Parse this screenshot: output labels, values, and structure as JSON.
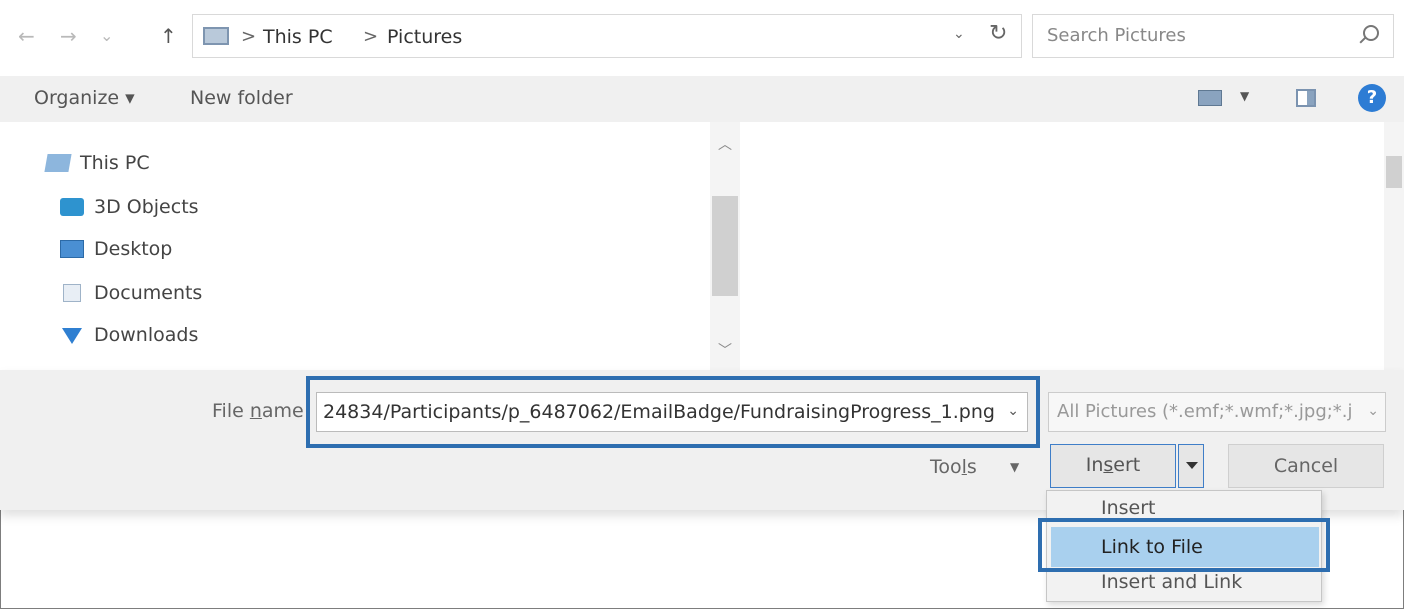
{
  "navigation": {
    "back": "←",
    "forward": "→",
    "recent": "⌄",
    "up": "↑"
  },
  "address_bar": {
    "path": [
      "This PC",
      "Pictures"
    ],
    "separator": ">",
    "dropdown": "⌄",
    "refresh": "↻"
  },
  "search": {
    "placeholder": "Search Pictures"
  },
  "toolbar": {
    "organize": "Organize ▾",
    "new_folder": "New folder",
    "help": "?"
  },
  "nav_pane": {
    "items": [
      {
        "label": "This PC",
        "icon": "pc-icon"
      },
      {
        "label": "3D Objects",
        "icon": "3d-objects-icon"
      },
      {
        "label": "Desktop",
        "icon": "desktop-icon"
      },
      {
        "label": "Documents",
        "icon": "documents-icon"
      },
      {
        "label": "Downloads",
        "icon": "downloads-icon"
      }
    ]
  },
  "file_name": {
    "label_prefix": "File ",
    "label_accel": "n",
    "label_suffix": "ame",
    "value": "24834/Participants/p_6487062/EmailBadge/FundraisingProgress_1.png"
  },
  "file_type": {
    "value": "All Pictures (*.emf;*.wmf;*.jpg;*.j"
  },
  "buttons": {
    "tools_prefix": "Too",
    "tools_accel": "l",
    "tools_suffix": "s",
    "insert_prefix": "In",
    "insert_accel": "s",
    "insert_suffix": "ert",
    "cancel": "Cancel"
  },
  "insert_menu": {
    "items": [
      "Insert",
      "Link to File",
      "Insert and Link"
    ],
    "selected": "Link to File"
  },
  "colors": {
    "highlight_box": "#2e6eb0",
    "menu_selected": "#a9d0ee",
    "help_blue": "#2d7cd4"
  }
}
